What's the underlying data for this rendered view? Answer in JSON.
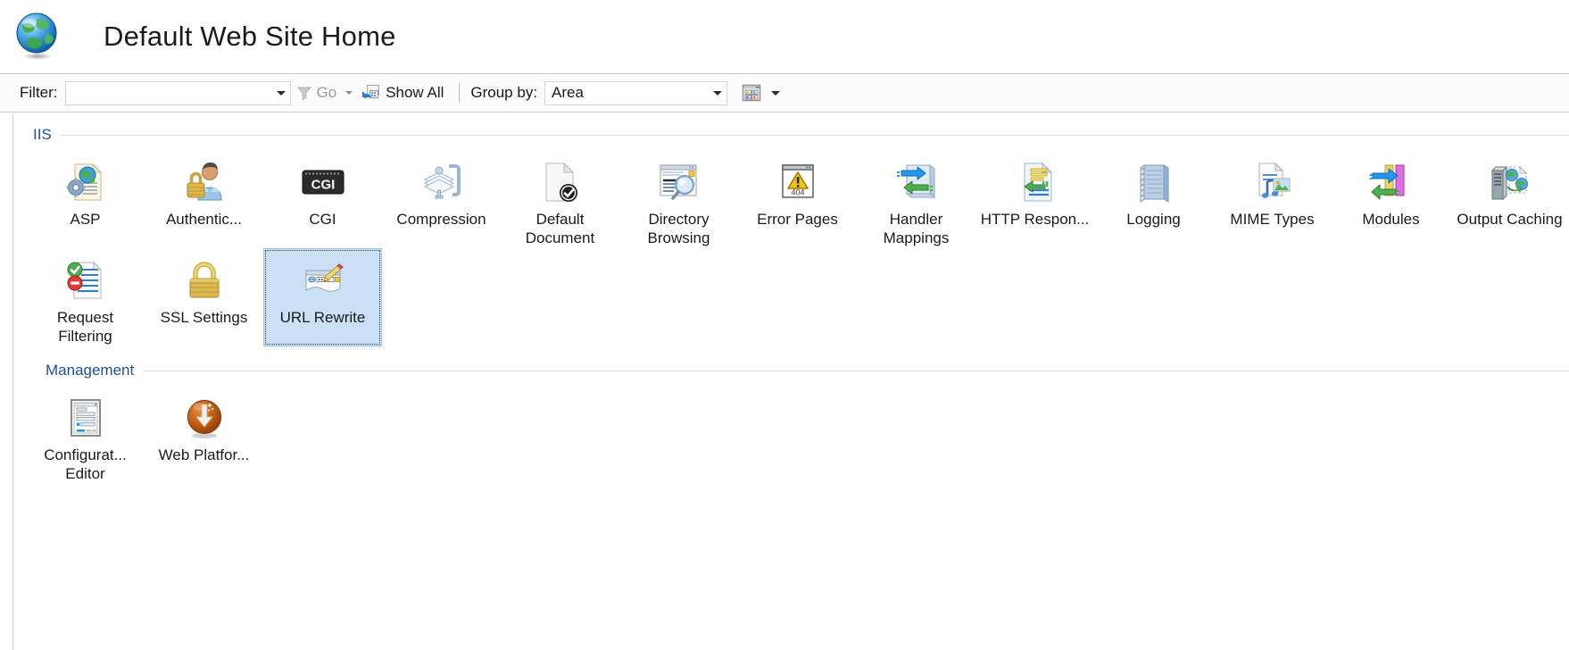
{
  "header": {
    "icon": "globe-icon",
    "title": "Default Web Site Home"
  },
  "toolbar": {
    "filter_label": "Filter:",
    "filter_value": "",
    "filter_placeholder": "",
    "go_label": "Go",
    "go_icon": "funnel-icon",
    "go_dropdown_icon": "chevron-down-icon",
    "show_all_label": "Show All",
    "show_all_icon": "show-all-icon",
    "group_by_label": "Group by:",
    "group_by_value": "Area",
    "view_icon": "view-options-icon",
    "view_dropdown_icon": "chevron-down-icon"
  },
  "sections": [
    {
      "title": "IIS",
      "tiles": [
        {
          "label": "ASP",
          "icon": "asp-icon",
          "selected": false
        },
        {
          "label": "Authentic...",
          "icon": "authentication-icon",
          "selected": false
        },
        {
          "label": "CGI",
          "icon": "cgi-icon",
          "selected": false
        },
        {
          "label": "Compression",
          "icon": "compression-icon",
          "selected": false
        },
        {
          "label": "Default Document",
          "icon": "default-document-icon",
          "selected": false
        },
        {
          "label": "Directory Browsing",
          "icon": "directory-browsing-icon",
          "selected": false
        },
        {
          "label": "Error Pages",
          "icon": "error-pages-icon",
          "selected": false
        },
        {
          "label": "Handler Mappings",
          "icon": "handler-mappings-icon",
          "selected": false
        },
        {
          "label": "HTTP Respon...",
          "icon": "http-response-headers-icon",
          "selected": false
        },
        {
          "label": "Logging",
          "icon": "logging-icon",
          "selected": false
        },
        {
          "label": "MIME Types",
          "icon": "mime-types-icon",
          "selected": false
        },
        {
          "label": "Modules",
          "icon": "modules-icon",
          "selected": false
        },
        {
          "label": "Output Caching",
          "icon": "output-caching-icon",
          "selected": false
        },
        {
          "label": "Request Filtering",
          "icon": "request-filtering-icon",
          "selected": false
        },
        {
          "label": "SSL Settings",
          "icon": "ssl-settings-icon",
          "selected": false
        },
        {
          "label": "URL Rewrite",
          "icon": "url-rewrite-icon",
          "selected": true
        }
      ]
    },
    {
      "title": "Management",
      "tiles": [
        {
          "label": "Configurat... Editor",
          "icon": "configuration-editor-icon",
          "selected": false
        },
        {
          "label": "Web Platfor...",
          "icon": "web-platform-installer-icon",
          "selected": false
        }
      ]
    }
  ],
  "colors": {
    "group_title": "#1f4e9c",
    "selection_bg": "#cce0f5",
    "selection_border": "#99c5e8",
    "toolbar_bg": "#fbfbfb"
  }
}
